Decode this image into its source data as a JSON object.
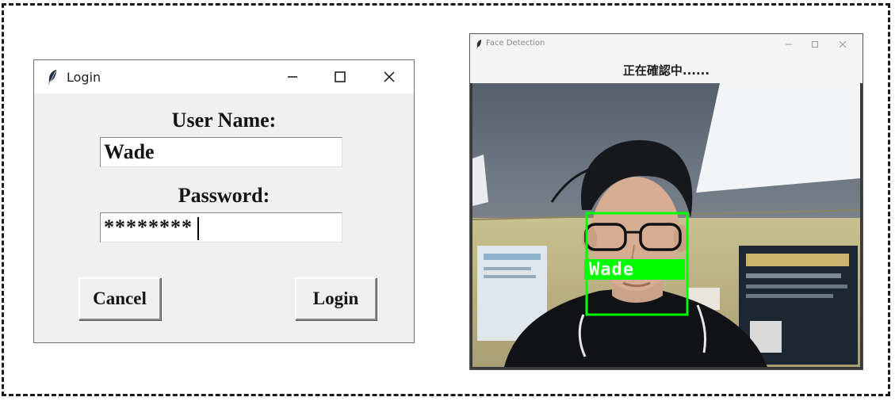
{
  "login_window": {
    "title": "Login",
    "user_label": "User Name:",
    "username_value": "Wade",
    "password_label": "Password:",
    "password_value": "********",
    "cancel_label": "Cancel",
    "login_label": "Login"
  },
  "face_window": {
    "title": "Face Detection",
    "status": "正在確認中......",
    "detected_name": "Wade",
    "box_color": "#00ff00"
  },
  "icons": [
    "feather-icon",
    "minimize-icon",
    "maximize-icon",
    "close-icon"
  ]
}
